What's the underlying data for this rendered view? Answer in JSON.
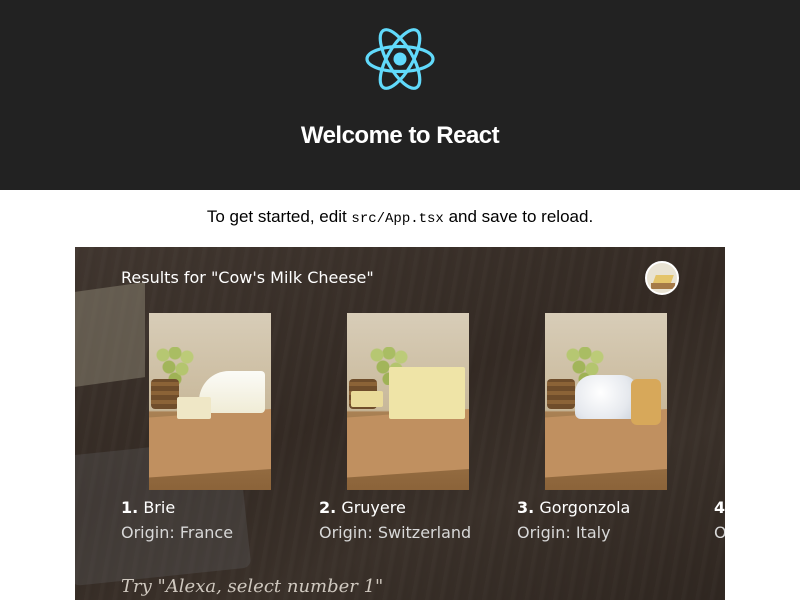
{
  "header": {
    "logo_icon": "react-logo-icon",
    "logo_color": "#61dafb",
    "background": "#222222",
    "title": "Welcome to React"
  },
  "intro": {
    "prefix": "To get started, edit ",
    "code": "src/App.tsx",
    "suffix": " and save to reload."
  },
  "display": {
    "results_title": "Results for \"Cow's Milk Cheese\"",
    "avatar_icon": "cheese-plate-icon",
    "items": [
      {
        "number": "1.",
        "name": "Brie",
        "origin": "Origin: France"
      },
      {
        "number": "2.",
        "name": "Gruyere",
        "origin": "Origin: Switzerland"
      },
      {
        "number": "3.",
        "name": "Gorgonzola",
        "origin": "Origin: Italy"
      }
    ],
    "next_item_number_partial": "4",
    "next_item_origin_partial": "O",
    "hint": "Try \"Alexa, select number 1\""
  }
}
